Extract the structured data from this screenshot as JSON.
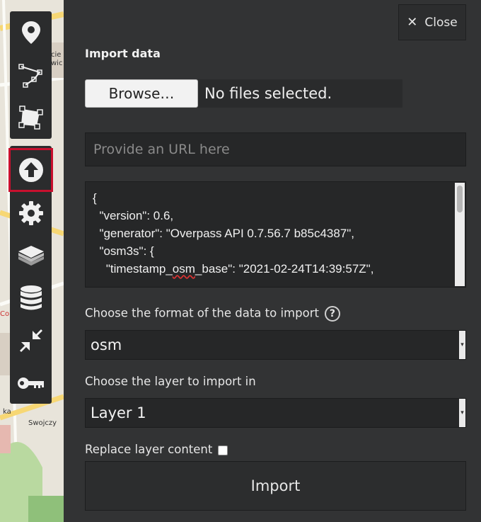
{
  "map": {
    "labels": [
      "cie",
      "wic",
      "Co",
      "ka",
      "Swojczy"
    ]
  },
  "toolbar": {
    "top_tools": [
      {
        "name": "marker-icon"
      },
      {
        "name": "polyline-icon"
      },
      {
        "name": "polygon-icon"
      }
    ],
    "bottom_tools": [
      {
        "name": "import-upload-icon",
        "active": true
      },
      {
        "name": "settings-gear-icon"
      },
      {
        "name": "layers-icon"
      },
      {
        "name": "database-icon"
      },
      {
        "name": "collapse-arrows-icon"
      },
      {
        "name": "key-icon"
      }
    ],
    "active_color": "#c8102e"
  },
  "panel": {
    "close_label": "Close",
    "title": "Import data",
    "browse_label": "Browse…",
    "file_status": "No files selected.",
    "url_placeholder": "Provide an URL here",
    "textarea_lines": [
      "{",
      "  \"version\": 0.6,",
      "  \"generator\": \"Overpass API 0.7.56.7 b85c4387\",",
      "  \"osm3s\": {",
      "    \"timestamp_osm_base\": \"2021-02-24T14:39:57Z\","
    ],
    "format_label": "Choose the format of the data to import",
    "format_value": "osm",
    "layer_label": "Choose the layer to import in",
    "layer_value": "Layer 1",
    "replace_label": "Replace layer content",
    "import_label": "Import"
  }
}
